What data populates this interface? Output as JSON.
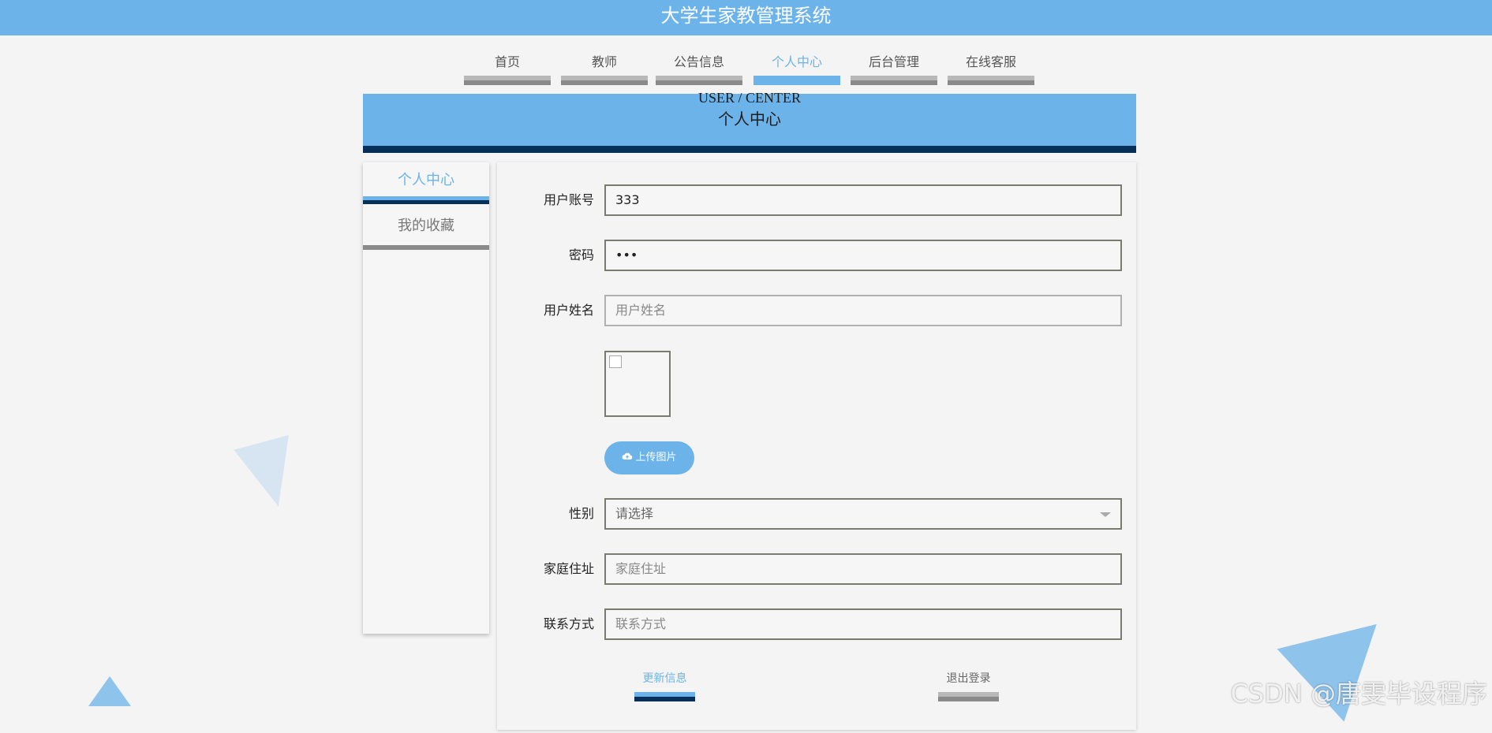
{
  "app_title": "大学生家教管理系统",
  "nav": {
    "items": [
      {
        "label": "首页"
      },
      {
        "label": "教师"
      },
      {
        "label": "公告信息"
      },
      {
        "label": "个人中心"
      },
      {
        "label": "后台管理"
      },
      {
        "label": "在线客服"
      }
    ],
    "active_index": 3
  },
  "banner": {
    "title_en": "USER / CENTER",
    "title_zh": "个人中心"
  },
  "sidebar": {
    "items": [
      {
        "label": "个人中心",
        "active": true
      },
      {
        "label": "我的收藏",
        "active": false
      }
    ]
  },
  "form": {
    "account": {
      "label": "用户账号",
      "value": "333"
    },
    "password": {
      "label": "密码",
      "value": "•••"
    },
    "name": {
      "label": "用户姓名",
      "placeholder": "用户姓名",
      "value": ""
    },
    "upload_label": "上传图片",
    "upload_icon": "cloud-upload-icon",
    "gender": {
      "label": "性别",
      "placeholder": "请选择"
    },
    "address": {
      "label": "家庭住址",
      "placeholder": "家庭住址"
    },
    "contact": {
      "label": "联系方式",
      "placeholder": "联系方式"
    }
  },
  "actions": {
    "update_label": "更新信息",
    "logout_label": "退出登录"
  },
  "watermark": "CSDN @唐雯毕设程序",
  "colors": {
    "accent": "#6cb3ea",
    "dark": "#06305a",
    "gray": "#8a8a8a"
  }
}
